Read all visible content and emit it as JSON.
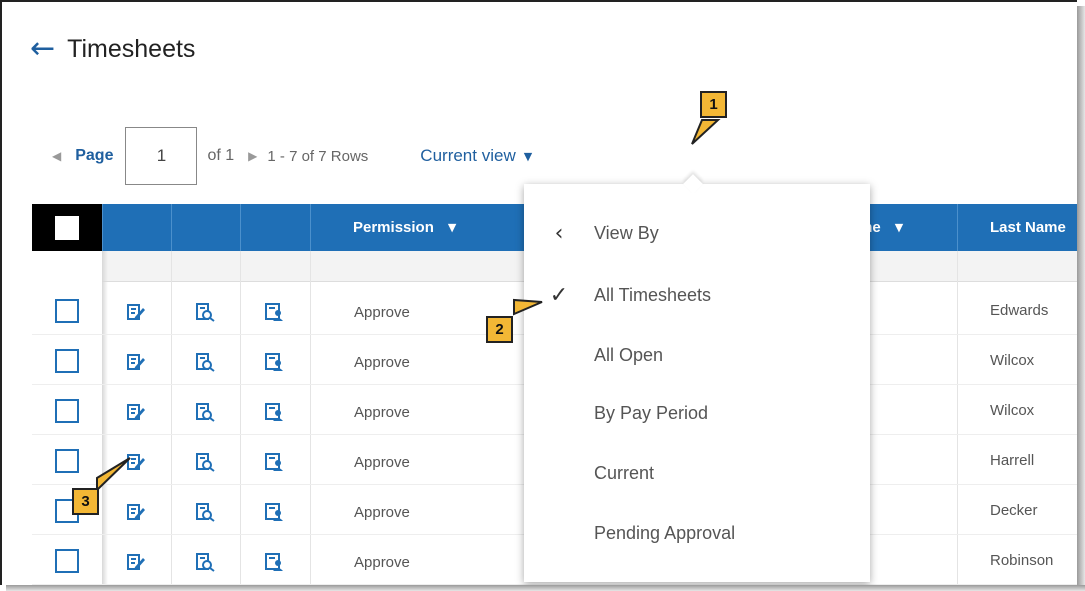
{
  "header": {
    "back_icon": "arrow-left-icon",
    "title": "Timesheets"
  },
  "pager": {
    "page_label": "Page",
    "page_value": "1",
    "of_label": "of 1",
    "rows_label": "1 - 7 of 7 Rows",
    "view_label": "Current view"
  },
  "table": {
    "columns": [
      "Permission",
      "me",
      "Last Name"
    ],
    "rows": [
      {
        "permission": "Approve",
        "last_name": "Edwards"
      },
      {
        "permission": "Approve",
        "last_name": "Wilcox"
      },
      {
        "permission": "Approve",
        "last_name": "Wilcox"
      },
      {
        "permission": "Approve",
        "last_name": "Harrell"
      },
      {
        "permission": "Approve",
        "last_name": "Decker"
      },
      {
        "permission": "Approve",
        "last_name": "Robinson"
      }
    ]
  },
  "menu": {
    "back_label": "View By",
    "items": [
      "All Timesheets",
      "All Open",
      "By Pay Period",
      "Current",
      "Pending Approval"
    ],
    "selected": "All Timesheets"
  },
  "callouts": [
    "1",
    "2",
    "3"
  ],
  "colors": {
    "accent": "#1f6fb6",
    "callout": "#f3b735"
  }
}
